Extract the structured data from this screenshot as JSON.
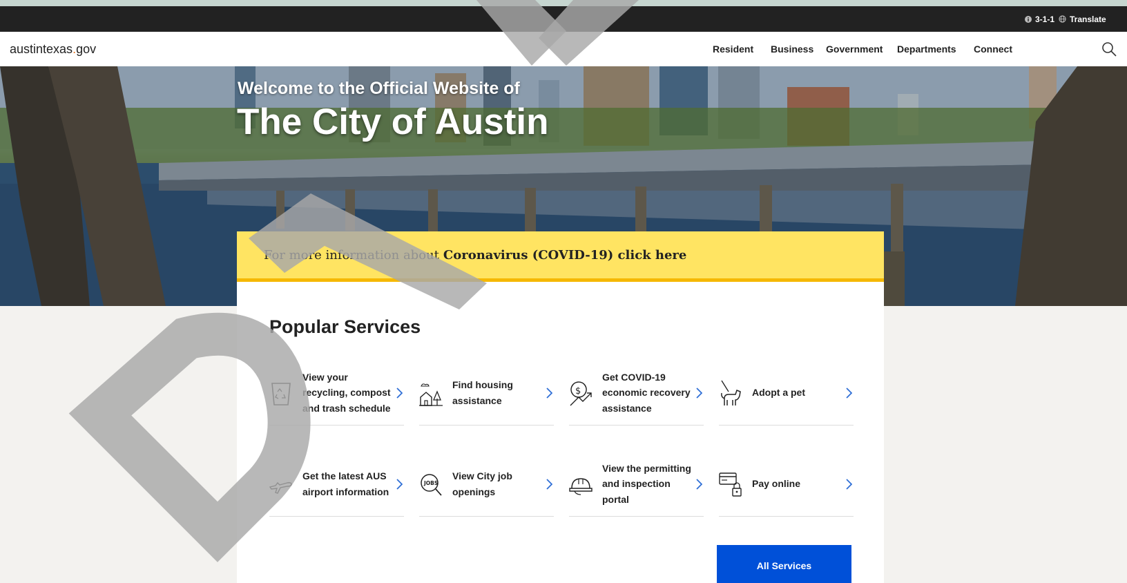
{
  "utility": {
    "phone_label": "3-1-1",
    "translate_label": "Translate"
  },
  "nav": {
    "logo": {
      "main": "austintexas",
      "dot": ".",
      "tld": "gov"
    },
    "items": [
      {
        "label": "Resident"
      },
      {
        "label": "Business"
      },
      {
        "label": "Government"
      },
      {
        "label": "Departments"
      },
      {
        "label": "Connect"
      }
    ],
    "search_icon": "search-icon"
  },
  "hero": {
    "subtitle": "Welcome to the Official Website of",
    "title": "The City of Austin"
  },
  "covid_banner": {
    "prefix": "For more information about",
    "link": "Coronavirus (COVID-19) click here"
  },
  "services": {
    "title": "Popular Services",
    "items": [
      {
        "label": "View your recycling, compost and trash schedule",
        "icon": "recycle-bin-icon"
      },
      {
        "label": "Find housing assistance",
        "icon": "house-icon"
      },
      {
        "label": "Get COVID-19 economic recovery assistance",
        "icon": "dollar-growth-icon"
      },
      {
        "label": "Adopt a pet",
        "icon": "dog-leash-icon"
      },
      {
        "label": "Get the latest AUS airport information",
        "icon": "airplane-icon"
      },
      {
        "label": "View City job openings",
        "icon": "jobs-search-icon"
      },
      {
        "label": "View the permitting and inspection portal",
        "icon": "hardhat-icon"
      },
      {
        "label": "Pay online",
        "icon": "credit-card-lock-icon"
      }
    ],
    "all_services_label": "All Services"
  },
  "colors": {
    "utility_bar": "#222222",
    "banner_yellow": "#ffe462",
    "banner_border": "#f5b800",
    "accent_blue": "#0050d8",
    "chevron_blue": "#2f6fd6",
    "logo_dot": "#e87722",
    "watermark_gray": "#a8a8a8"
  }
}
